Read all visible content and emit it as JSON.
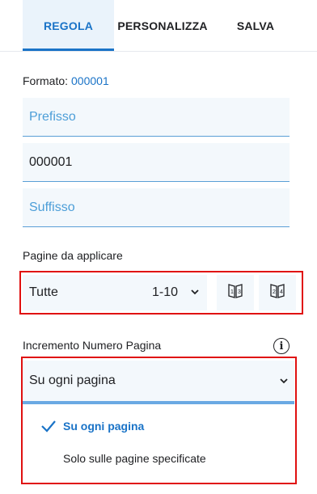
{
  "tabs": [
    {
      "label": "REGOLA",
      "active": true
    },
    {
      "label": "PERSONALIZZA",
      "active": false
    },
    {
      "label": "SALVA",
      "active": false
    }
  ],
  "format": {
    "label": "Formato:",
    "value": "000001"
  },
  "fields": {
    "prefix_placeholder": "Prefisso",
    "number_value": "000001",
    "suffix_placeholder": "Suffisso"
  },
  "pages": {
    "label": "Pagine da applicare",
    "selected": "Tutte",
    "range": "1-10"
  },
  "increment": {
    "label": "Incremento Numero Pagina",
    "selected": "Su ogni pagina",
    "options": [
      {
        "label": "Su ogni pagina",
        "selected": true
      },
      {
        "label": "Solo sulle pagine specificate",
        "selected": false
      }
    ]
  },
  "colors": {
    "accent": "#1a73c7",
    "highlight_border": "#e01010",
    "field_bg": "#f3f8fc"
  },
  "icons": [
    "chevron-down-icon",
    "odd-pages-icon",
    "even-pages-icon",
    "info-icon",
    "checkmark-icon"
  ]
}
